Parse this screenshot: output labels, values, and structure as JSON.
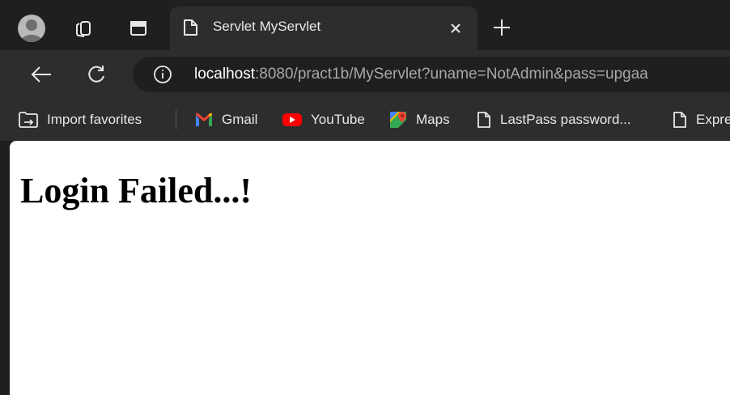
{
  "tab": {
    "title": "Servlet MyServlet"
  },
  "addressbar": {
    "url_host": "localhost",
    "url_rest": ":8080/pract1b/MyServlet?uname=NotAdmin&pass=upgaa"
  },
  "favorites": {
    "import_label": "Import favorites",
    "items": [
      {
        "label": "Gmail",
        "icon": "gmail-icon"
      },
      {
        "label": "YouTube",
        "icon": "youtube-icon"
      },
      {
        "label": "Maps",
        "icon": "maps-icon"
      },
      {
        "label": "LastPass password...",
        "icon": "page-icon"
      },
      {
        "label": "Expre",
        "icon": "page-icon"
      }
    ]
  },
  "page": {
    "heading": "Login Failed...!"
  },
  "colors": {
    "tabstrip": "#1f1f1f",
    "toolbar": "#2d2d2d",
    "content": "#ffffff",
    "youtube_red": "#ff0000"
  }
}
